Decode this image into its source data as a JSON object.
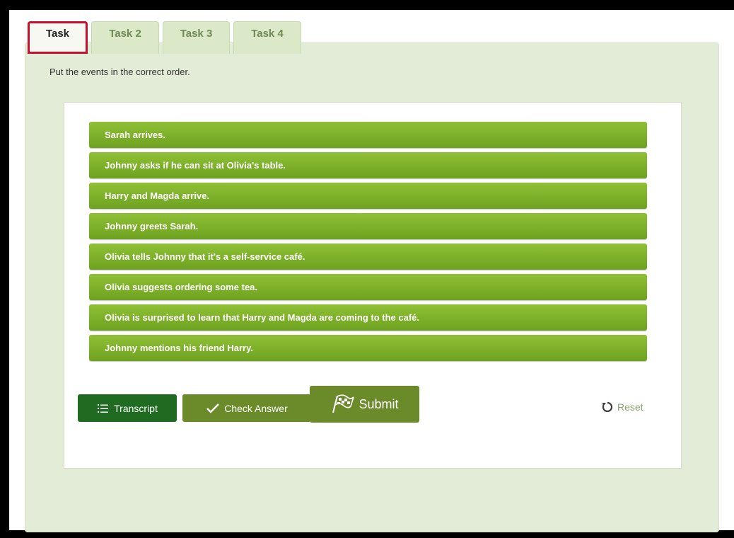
{
  "tabs": [
    {
      "label": "Task",
      "active": true
    },
    {
      "label": "Task 2",
      "active": false
    },
    {
      "label": "Task 3",
      "active": false
    },
    {
      "label": "Task 4",
      "active": false
    }
  ],
  "instructions": "Put the events in the correct order.",
  "events": [
    "Sarah arrives.",
    "Johnny asks if he can sit at Olivia's table.",
    "Harry and Magda arrive.",
    "Johnny greets Sarah.",
    "Olivia tells Johnny that it's a self-service café.",
    "Olivia suggests ordering some tea.",
    "Olivia is surprised to learn that Harry and Magda are coming to the café.",
    "Johnny mentions his friend Harry."
  ],
  "buttons": {
    "transcript": "Transcript",
    "check_answer": "Check Answer",
    "submit": "Submit",
    "reset": "Reset"
  },
  "icons": {
    "transcript": "list-icon",
    "check_answer": "checkmark-icon",
    "submit": "checkered-flag-icon",
    "reset": "refresh-icon"
  },
  "colors": {
    "item_green": "#7cb02a",
    "panel_bg": "#e3ecd6",
    "active_tab_highlight": "#c8102e",
    "transcript_btn": "#1f6b22",
    "check_btn": "#6b8a2a"
  }
}
